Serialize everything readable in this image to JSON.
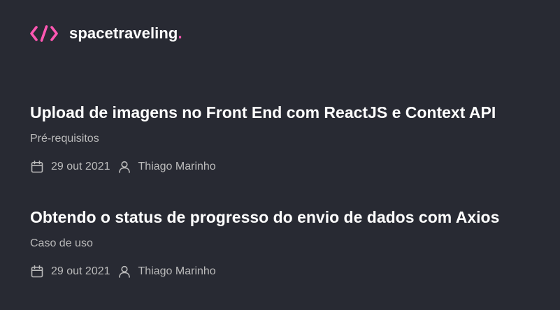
{
  "header": {
    "brand": "spacetraveling",
    "brand_dot": ".",
    "logo_icon": "code-brackets-icon",
    "colors": {
      "accent": "#ff57b2",
      "background": "#282a33",
      "title": "#ffffff",
      "muted": "#bbbbbb"
    }
  },
  "posts": [
    {
      "title": "Upload de imagens no Front End com ReactJS e Context API",
      "subtitle": "Pré-requisitos",
      "date": "29 out 2021",
      "author": "Thiago Marinho",
      "date_icon": "calendar-icon",
      "author_icon": "user-icon"
    },
    {
      "title": "Obtendo o status de progresso do envio de dados com Axios",
      "subtitle": "Caso de uso",
      "date": "29 out 2021",
      "author": "Thiago Marinho",
      "date_icon": "calendar-icon",
      "author_icon": "user-icon"
    }
  ]
}
